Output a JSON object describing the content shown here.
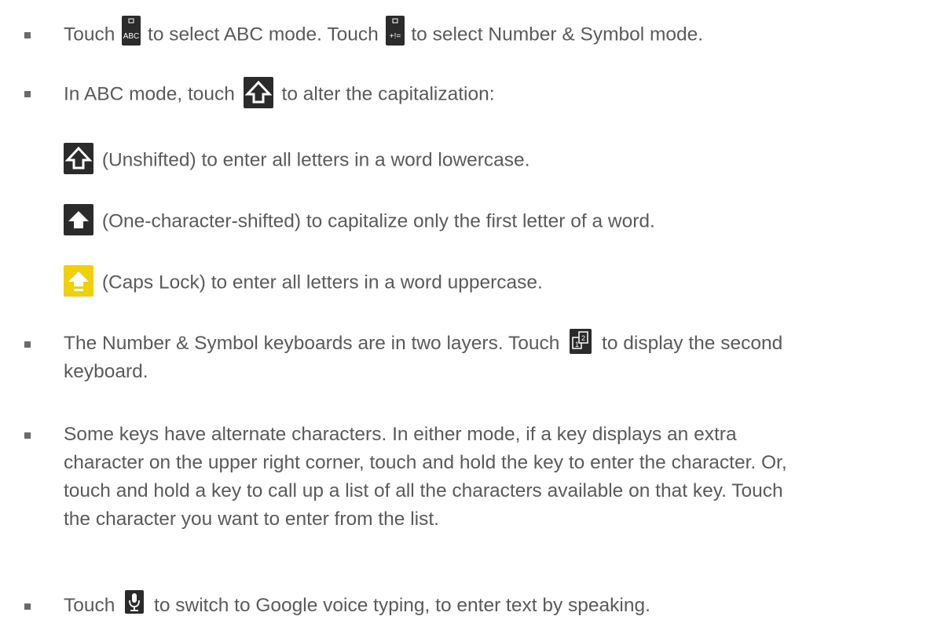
{
  "bullets": {
    "b1": {
      "t1": "Touch",
      "t2": "to select ABC mode. Touch",
      "t3": "to select Number & Symbol mode.",
      "key_abc": {
        "label": "ABC",
        "icon": "abc-mode-key-icon"
      },
      "key_sym": {
        "label": "+!=",
        "icon": "number-symbol-key-icon"
      }
    },
    "b2": {
      "t1": "In ABC mode, touch",
      "t2": "to alter the capitalization:"
    },
    "b2_sub": [
      {
        "text": "(Unshifted) to enter all letters in a word lowercase.",
        "icon": "shift-unshifted-icon"
      },
      {
        "text": "(One-character-shifted) to capitalize only the first letter of a word.",
        "icon": "shift-one-character-icon"
      },
      {
        "text": "(Caps Lock) to enter all letters in a word uppercase.",
        "icon": "caps-lock-icon"
      }
    ],
    "b3": {
      "t1": "The Number & Symbol keyboards are in two layers. Touch",
      "t2": "to display the second",
      "t3": "keyboard.",
      "key_label_1": "1",
      "key_label_2": "2"
    },
    "b4": {
      "line1": "Some keys have alternate characters. In either mode, if a key displays an extra",
      "line2": "character on the upper right corner, touch and hold the key to enter the character. Or,",
      "line3": "touch and hold a key to call up a list of all the characters available on that key. Touch",
      "line4": "the character you want to enter from the list."
    },
    "b5": {
      "t1": "Touch",
      "t2": "to switch to Google voice typing, to enter text by speaking."
    }
  },
  "colors": {
    "text": "#5a5a5a",
    "key_background": "#2b2b2b",
    "caps_lock": "#f0cf0b"
  }
}
